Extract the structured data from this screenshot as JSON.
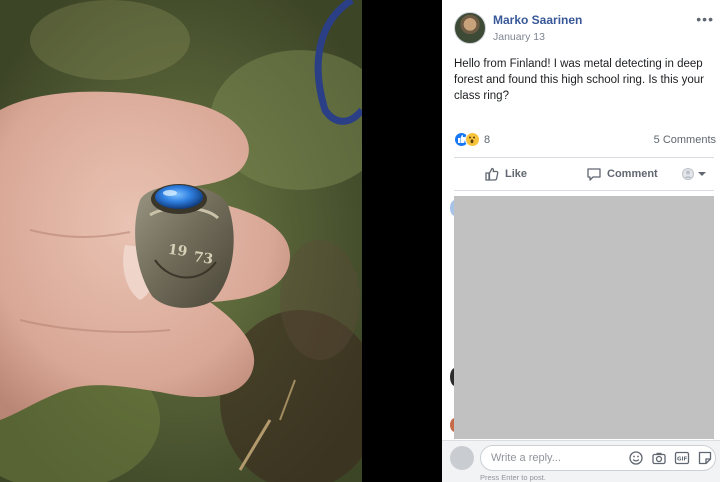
{
  "post": {
    "author": "Marko Saarinen",
    "date": "January 13",
    "more_label": "•••",
    "text": "Hello from Finland! I was metal detecting in deep forest and found this high school ring. Is this your class ring?"
  },
  "reactions": {
    "types": [
      "like",
      "wow"
    ],
    "count": "8",
    "comments": "5 Comments"
  },
  "actions": {
    "like": "Like",
    "comment": "Comment"
  },
  "reply": {
    "placeholder": "Write a reply...",
    "hint": "Press Enter to post.",
    "icons": [
      "emoji-icon",
      "camera-icon",
      "gif-icon",
      "sticker-icon"
    ]
  },
  "photo": {
    "ring_engraving": "1973",
    "stone_color": "#2f7fe0"
  }
}
